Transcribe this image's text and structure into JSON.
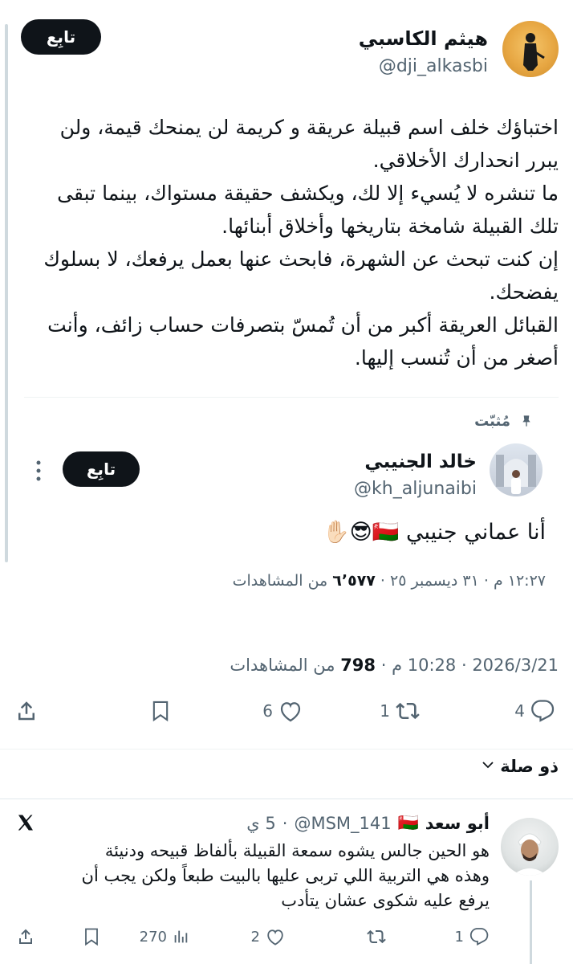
{
  "author": {
    "name": "هيثم الكاسبي",
    "handle": "@dji_alkasbi",
    "follow_label": "تابِع"
  },
  "tweet": {
    "text": "اختباؤك خلف اسم قبيلة عريقة و كريمة لن يمنحك قيمة، ولن\nيبرر انحدارك الأخلاقي.\nما تنشره لا يُسيء إلا لك، ويكشف حقيقة مستواك، بينما تبقى\nتلك القبيلة شامخة بتاريخها وأخلاق أبنائها.\nإن كنت تبحث عن الشهرة، فابحث عنها بعمل يرفعك، لا بسلوك\nيفضحك.\nالقبائل العريقة أكبر من أن تُمسّ بتصرفات حساب زائف، وأنت\nأصغر من أن تُنسب إليها.",
    "meta": {
      "date": "2026/3/21",
      "time": "10:28 م",
      "views_count": "798",
      "views_label": "من المشاهدات"
    },
    "actions": {
      "replies": "4",
      "retweets": "1",
      "likes": "6"
    }
  },
  "quoted": {
    "pinned_label": "مُثبّت",
    "name": "خالد الجنيبي",
    "handle": "@kh_aljunaibi",
    "follow_label": "تابِع",
    "text": "أنا عماني جنيبي 🇴🇲😎✋🏻",
    "meta": "١٢:٢٧ م · ٣١ ديسمبر ٢٥ · ",
    "views_count": "٦٬٥٧٧",
    "views_label": "من المشاهدات"
  },
  "relevance_label": "ذو صلة",
  "reply": {
    "name": "أبو سعد",
    "flag": "🇴🇲",
    "handle": "@MSM_141",
    "time": "5 ي",
    "text": "هو الحين جالس يشوه سمعة القبيلة بألفاظ قبيحه ودنيئة\nوهذه هي التربية اللي تربى عليها بالبيت طبعاً ولكن يجب أن\nيرفع عليه شكوى عشان يتأدب",
    "actions": {
      "replies": "1",
      "likes": "2",
      "views": "270"
    }
  },
  "icons": {
    "reply": "reply-icon",
    "retweet": "retweet-icon",
    "like": "like-icon",
    "bookmark": "bookmark-icon",
    "share": "share-icon",
    "views": "views-icon",
    "pin": "pin-icon",
    "more": "more-icon",
    "x_logo": "x-logo-icon",
    "chevron": "chevron-down-icon"
  },
  "colors": {
    "text": "#0f1419",
    "muted": "#536471",
    "button_bg": "#0f1419",
    "avatar_accent": "#e7a743"
  }
}
